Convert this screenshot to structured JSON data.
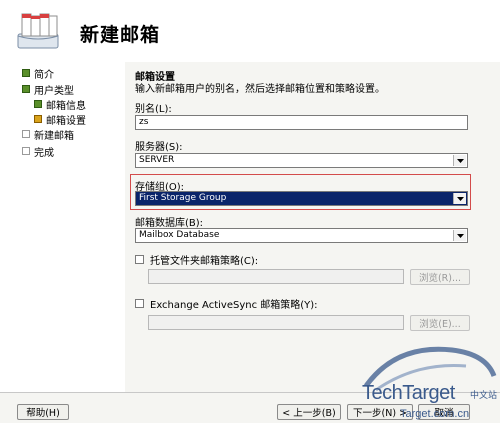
{
  "window": {
    "title": "新建邮箱"
  },
  "nav": {
    "items": [
      {
        "label": "简介",
        "state": "done"
      },
      {
        "label": "用户类型",
        "state": "done"
      },
      {
        "label": "邮箱信息",
        "state": "done"
      },
      {
        "label": "邮箱设置",
        "state": "current"
      },
      {
        "label": "新建邮箱",
        "state": "pending"
      },
      {
        "label": "完成",
        "state": "pending"
      }
    ]
  },
  "section": {
    "title": "邮箱设置",
    "description": "输入新邮箱用户的别名，然后选择邮箱位置和策略设置。"
  },
  "form": {
    "alias": {
      "label": "别名(L):",
      "value": "zs"
    },
    "server": {
      "label": "服务器(S):",
      "value": "SERVER"
    },
    "storage_group": {
      "label": "存储组(O):",
      "value": "First Storage Group"
    },
    "mailbox_db": {
      "label": "邮箱数据库(B):",
      "value": "Mailbox Database"
    },
    "managed_folder": {
      "label": "托管文件夹邮箱策略(C):",
      "checked": false,
      "browse_label": "浏览(R)..."
    },
    "activesync": {
      "label": "Exchange ActiveSync 邮箱策略(Y):",
      "checked": false,
      "browse_label": "浏览(E)..."
    }
  },
  "buttons": {
    "help": "帮助(H)",
    "back": "< 上一步(B)",
    "next": "下一步(N) >",
    "cancel": "取消"
  },
  "watermark": {
    "brand": "TechTarget",
    "brand_cn": "中文站",
    "url": "Target.com.cn"
  },
  "colors": {
    "selection": "#0a246a",
    "highlight_border": "#d34b4b",
    "nav_done": "#5a8f2a",
    "nav_current": "#d9a31b"
  }
}
